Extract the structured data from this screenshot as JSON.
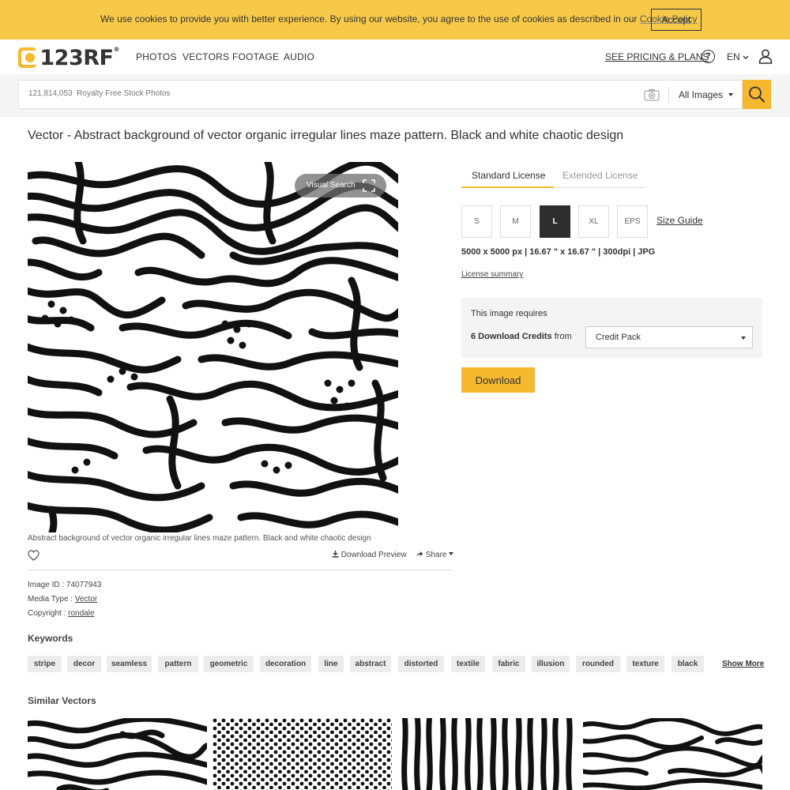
{
  "cookie": {
    "text": "We use cookies to provide you with better experience. By using our website, you agree to the use of cookies as described in our",
    "link": "Cookie Policy",
    "accept": "Accept"
  },
  "header": {
    "logo_text": "123RF",
    "logo_reg": "®",
    "nav": [
      "PHOTOS",
      "VECTORS",
      "FOOTAGE",
      "AUDIO"
    ],
    "pricing": "SEE PRICING & PLANS",
    "help": "?",
    "lang": "EN"
  },
  "search": {
    "placeholder": "121,814,053  Royalty Free Stock Photos",
    "filter": "All Images"
  },
  "page_title": "Vector - Abstract background of vector organic irregular lines maze pattern. Black and white chaotic design",
  "image": {
    "visual_search": "Visual Search",
    "caption": "Abstract background of vector organic irregular lines maze pattern. Black and white chaotic design",
    "download_preview": "Download Preview",
    "share": "Share"
  },
  "meta": {
    "image_id_label": "Image ID : ",
    "image_id": "74077943",
    "media_type_label": "Media Type : ",
    "media_type": "Vector",
    "copyright_label": "Copyright : ",
    "copyright": "rondale"
  },
  "keywords": {
    "heading": "Keywords",
    "items": [
      "stripe",
      "decor",
      "seamless",
      "pattern",
      "geometric",
      "decoration",
      "line",
      "abstract",
      "distorted",
      "textile",
      "fabric",
      "illusion",
      "rounded",
      "texture",
      "black"
    ],
    "show_more": "Show More"
  },
  "similar": {
    "heading": "Similar Vectors"
  },
  "license": {
    "tabs": [
      "Standard License",
      "Extended License"
    ],
    "active_tab": 0,
    "sizes": [
      "S",
      "M",
      "L",
      "XL",
      "EPS"
    ],
    "active_size": "L",
    "size_guide": "Size Guide",
    "spec": "5000 x 5000 px | 16.67 \" x 16.67 \" | 300dpi | JPG",
    "summary": "License summary",
    "requires": "This image requires",
    "credits_bold": "6 Download Credits",
    "credits_from": " from",
    "credit_option": "Credit Pack",
    "download": "Download"
  },
  "colors": {
    "accent": "#f5b82e",
    "cookie_bg": "#f7c948",
    "dark": "#2d2d2d"
  }
}
